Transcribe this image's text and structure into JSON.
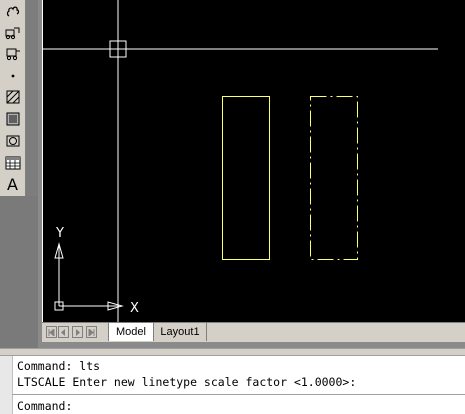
{
  "toolbar": {
    "tools": [
      {
        "name": "revision-cloud"
      },
      {
        "name": "insert-block"
      },
      {
        "name": "make-block"
      },
      {
        "name": "point"
      },
      {
        "name": "hatch"
      },
      {
        "name": "gradient"
      },
      {
        "name": "region"
      },
      {
        "name": "table"
      },
      {
        "name": "multiline-text",
        "glyph": "A"
      }
    ]
  },
  "viewport": {
    "background": "#000000",
    "crosshair_color": "#ffffff",
    "rect_color": "#ffff66",
    "ucs": {
      "x_label": "X",
      "y_label": "Y"
    }
  },
  "tabs": {
    "model": "Model",
    "layout1": "Layout1"
  },
  "command": {
    "history": [
      "Command: lts",
      "LTSCALE Enter new linetype scale factor <1.0000>:"
    ],
    "prompt": "Command:"
  }
}
